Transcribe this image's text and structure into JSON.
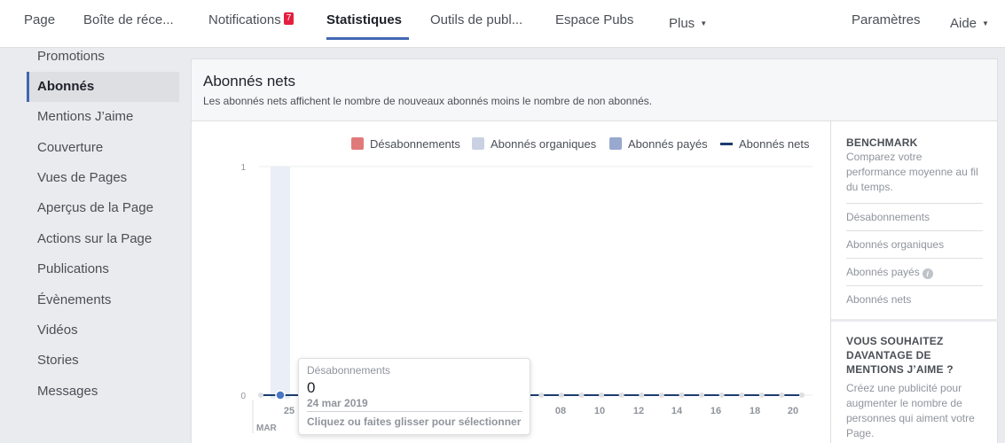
{
  "nav": {
    "items": [
      {
        "label": "Page"
      },
      {
        "label": "Boîte de réce..."
      },
      {
        "label": "Notifications",
        "badge": "7"
      },
      {
        "label": "Statistiques"
      },
      {
        "label": "Outils de publ..."
      },
      {
        "label": "Espace Pubs"
      },
      {
        "label": "Plus"
      }
    ],
    "settings": "Paramètres",
    "help": "Aide"
  },
  "sidebar": {
    "items": [
      {
        "label": "Promotions"
      },
      {
        "label": "Abonnés"
      },
      {
        "label": "Mentions J’aime"
      },
      {
        "label": "Couverture"
      },
      {
        "label": "Vues de Pages"
      },
      {
        "label": "Aperçus de la Page"
      },
      {
        "label": "Actions sur la Page"
      },
      {
        "label": "Publications"
      },
      {
        "label": "Évènements"
      },
      {
        "label": "Vidéos"
      },
      {
        "label": "Stories"
      },
      {
        "label": "Messages"
      }
    ],
    "active": "Abonnés"
  },
  "panel": {
    "title": "Abonnés nets",
    "subtitle": "Les abonnés nets affichent le nombre de nouveaux abonnés moins le nombre de non abonnés."
  },
  "legend": [
    {
      "label": "Désabonnements",
      "color": "#e07a7a",
      "kind": "swatch"
    },
    {
      "label": "Abonnés organiques",
      "color": "#c9d1e3",
      "kind": "swatch"
    },
    {
      "label": "Abonnés payés",
      "color": "#98a8cf",
      "kind": "swatch"
    },
    {
      "label": "Abonnés nets",
      "color": "#1d3c6e",
      "kind": "line"
    }
  ],
  "chart_data": {
    "type": "line",
    "ylim": [
      0,
      1
    ],
    "y_ticks": [
      "0",
      "1"
    ],
    "x_tick_labels": [
      "25",
      "08",
      "10",
      "12",
      "14",
      "16",
      "18",
      "20"
    ],
    "x_month_label": "MAR",
    "point_count": 28,
    "series": [
      {
        "name": "Abonnés nets",
        "color": "#1d3c6e",
        "values": [
          0,
          0,
          0,
          0,
          0,
          0,
          0,
          0,
          0,
          0,
          0,
          0,
          0,
          0,
          0,
          0,
          0,
          0,
          0,
          0,
          0,
          0,
          0,
          0,
          0,
          0,
          0,
          0
        ]
      }
    ],
    "highlight_color": "#e9eef7",
    "marker_color": "#4a76c4"
  },
  "tooltip": {
    "label": "Désabonnements",
    "value": "0",
    "date": "24 mar 2019",
    "hint": "Cliquez ou faites glisser pour sélectionner"
  },
  "benchmark": {
    "title": "BENCHMARK",
    "description": "Comparez votre performance moyenne au fil du temps.",
    "links": [
      {
        "label": "Désabonnements"
      },
      {
        "label": "Abonnés organiques"
      },
      {
        "label": "Abonnés payés",
        "info": "i"
      },
      {
        "label": "Abonnés nets"
      }
    ]
  },
  "promo": {
    "title": "VOUS SOUHAITEZ DAVANTAGE DE MENTIONS J’AIME ?",
    "description": "Créez une publicité pour augmenter le nombre de personnes qui aiment votre Page."
  }
}
